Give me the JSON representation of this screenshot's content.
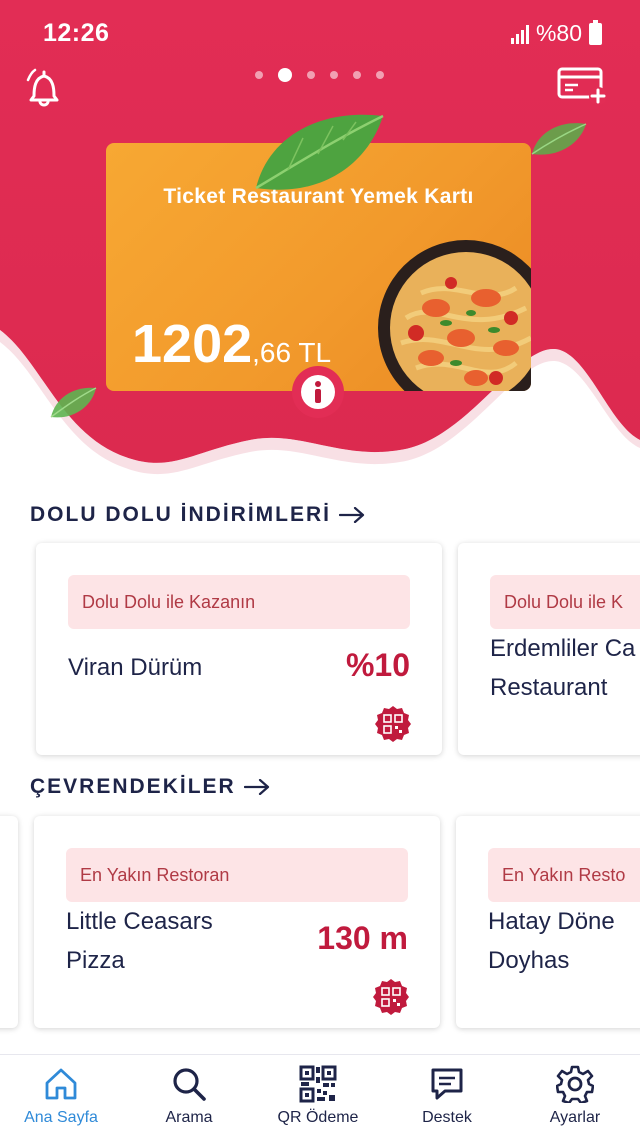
{
  "status_bar": {
    "time": "12:26",
    "battery": "%80"
  },
  "colors": {
    "brand_red": "#e22d55",
    "card_orange": "#f7a833",
    "accent_red": "#c01a3d",
    "tag_bg": "#fde4e6",
    "active_nav": "#2f8ad8",
    "dark_text": "#1e2448"
  },
  "header": {
    "carousel": {
      "page_count": 6,
      "active_index": 1
    },
    "card": {
      "title": "Ticket Restaurant Yemek Kartı",
      "balance_main": "1202",
      "balance_decimal": ",66 TL"
    }
  },
  "discounts": {
    "title": "DOLU DOLU İNDİRİMLERİ",
    "items": [
      {
        "tag": "Dolu Dolu ile Kazanın",
        "name": "Viran Dürüm",
        "value": "%10"
      },
      {
        "tag": "Dolu Dolu ile K",
        "name_line1": "Erdemliler Ca",
        "name_line2": "Restaurant"
      }
    ]
  },
  "nearby": {
    "title": "ÇEVRENDEKİLER",
    "items": [
      {
        "tag": "En Yakın Restoran",
        "name_line1": "Little Ceasars",
        "name_line2": "Pizza",
        "value": "130 m"
      },
      {
        "tag": "En Yakın Resto",
        "name_line1": "Hatay Döne",
        "name_line2": "Doyhas"
      }
    ]
  },
  "nav": [
    {
      "label": "Ana Sayfa",
      "icon": "home-icon",
      "active": true
    },
    {
      "label": "Arama",
      "icon": "search-icon"
    },
    {
      "label": "QR Ödeme",
      "icon": "qr-code-icon"
    },
    {
      "label": "Destek",
      "icon": "chat-icon"
    },
    {
      "label": "Ayarlar",
      "icon": "gear-icon"
    }
  ]
}
